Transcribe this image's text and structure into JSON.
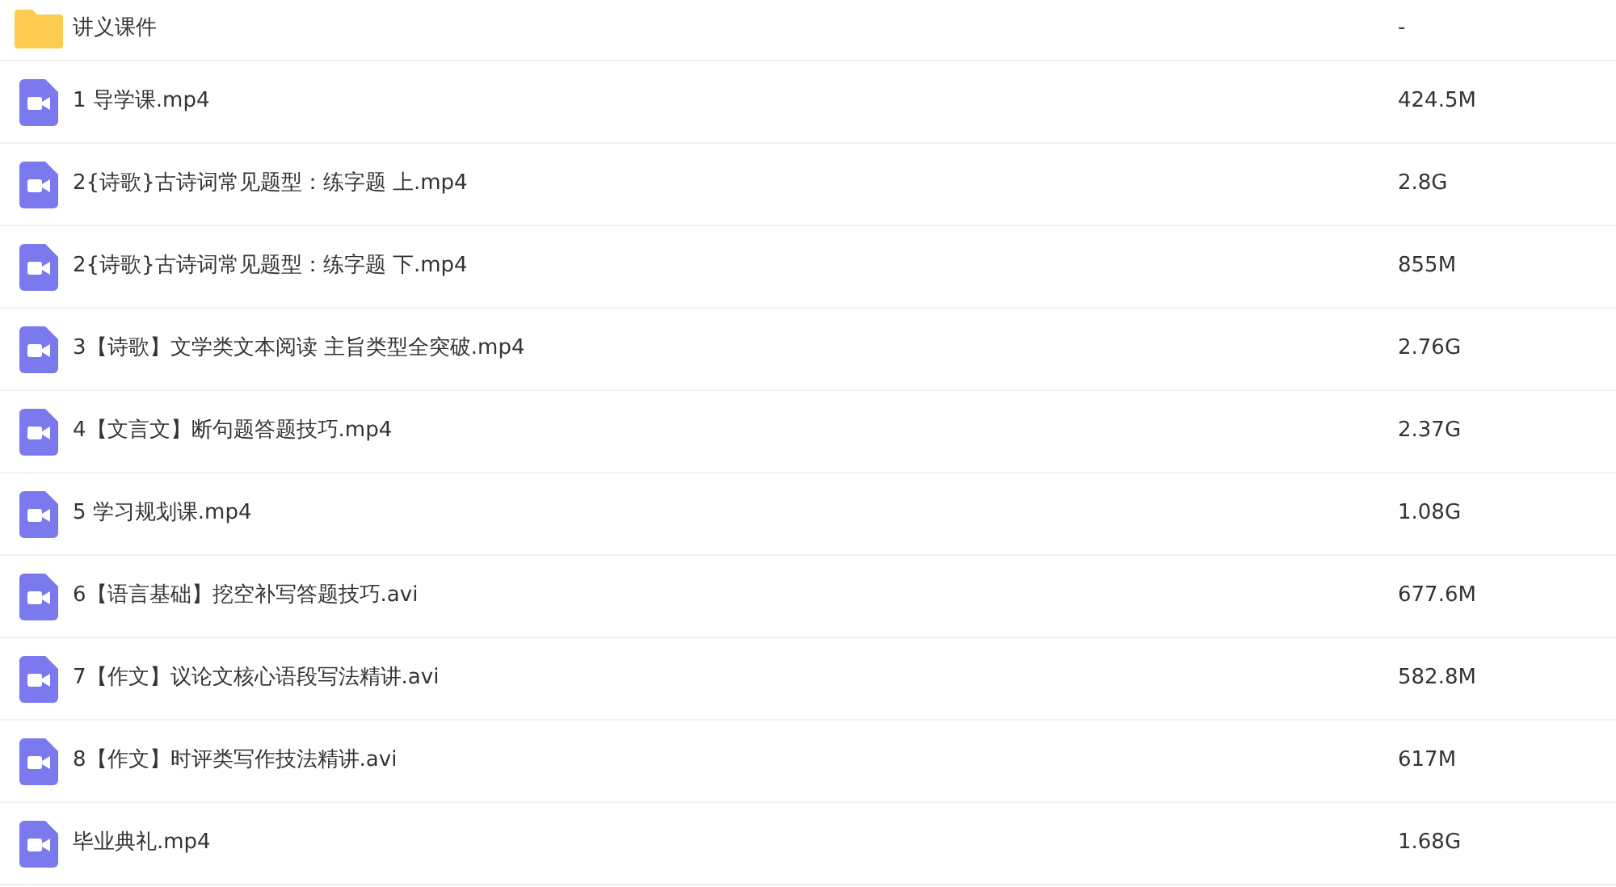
{
  "files": [
    {
      "kind": "folder",
      "name": "讲义课件",
      "size": "-"
    },
    {
      "kind": "video",
      "name": "1 导学课.mp4",
      "size": "424.5M"
    },
    {
      "kind": "video",
      "name": "2{诗歌}古诗词常见题型：练字题 上.mp4",
      "size": "2.8G"
    },
    {
      "kind": "video",
      "name": "2{诗歌}古诗词常见题型：练字题 下.mp4",
      "size": "855M"
    },
    {
      "kind": "video",
      "name": "3【诗歌】文学类文本阅读 主旨类型全突破.mp4",
      "size": "2.76G"
    },
    {
      "kind": "video",
      "name": "4【文言文】断句题答题技巧.mp4",
      "size": "2.37G"
    },
    {
      "kind": "video",
      "name": "5 学习规划课.mp4",
      "size": "1.08G"
    },
    {
      "kind": "video",
      "name": "6【语言基础】挖空补写答题技巧.avi",
      "size": "677.6M"
    },
    {
      "kind": "video",
      "name": "7【作文】议论文核心语段写法精讲.avi",
      "size": "582.8M"
    },
    {
      "kind": "video",
      "name": "8【作文】时评类写作技法精讲.avi",
      "size": "617M"
    },
    {
      "kind": "video",
      "name": "毕业典礼.mp4",
      "size": "1.68G"
    }
  ]
}
